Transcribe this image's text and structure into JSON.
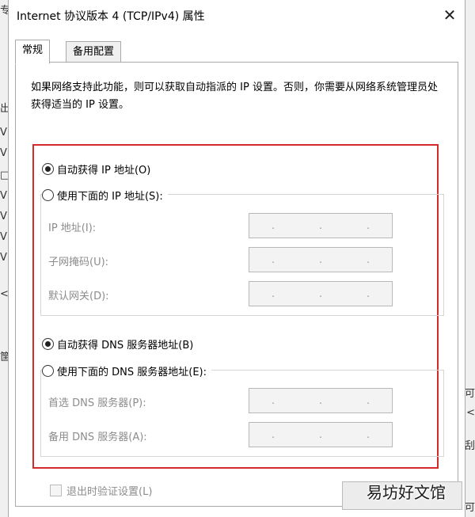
{
  "dialog": {
    "title": "Internet 协议版本 4 (TCP/IPv4) 属性",
    "close_label": "✕"
  },
  "tabs": [
    {
      "label": "常规",
      "active": true
    },
    {
      "label": "备用配置",
      "active": false
    }
  ],
  "description": "如果网络支持此功能，则可以获取自动指派的 IP 设置。否则，你需要从网络系统管理员处获得适当的 IP 设置。",
  "ip_section": {
    "auto_label": "自动获得 IP 地址(O)",
    "auto_selected": true,
    "manual_label": "使用下面的 IP 地址(S):",
    "manual_selected": false,
    "fields": [
      {
        "label": "IP 地址(I):"
      },
      {
        "label": "子网掩码(U):"
      },
      {
        "label": "默认网关(D):"
      }
    ]
  },
  "dns_section": {
    "auto_label": "自动获得 DNS 服务器地址(B)",
    "auto_selected": true,
    "manual_label": "使用下面的 DNS 服务器地址(E):",
    "manual_selected": false,
    "fields": [
      {
        "label": "首选 DNS 服务器(P):"
      },
      {
        "label": "备用 DNS 服务器(A):"
      }
    ]
  },
  "ip_separator": ".",
  "validate_label": "退出时验证设置(L)",
  "watermark": "易坊好文馆",
  "colors": {
    "highlight_border": "#d42a2a",
    "disabled_text": "#8c8c8c"
  },
  "background_fragments": {
    "left": [
      "专",
      "出",
      "V",
      "V",
      "□",
      "V",
      "V",
      "V",
      "V",
      "<",
      "筐"
    ],
    "right": [
      "可",
      "<",
      "刮",
      "可"
    ]
  }
}
